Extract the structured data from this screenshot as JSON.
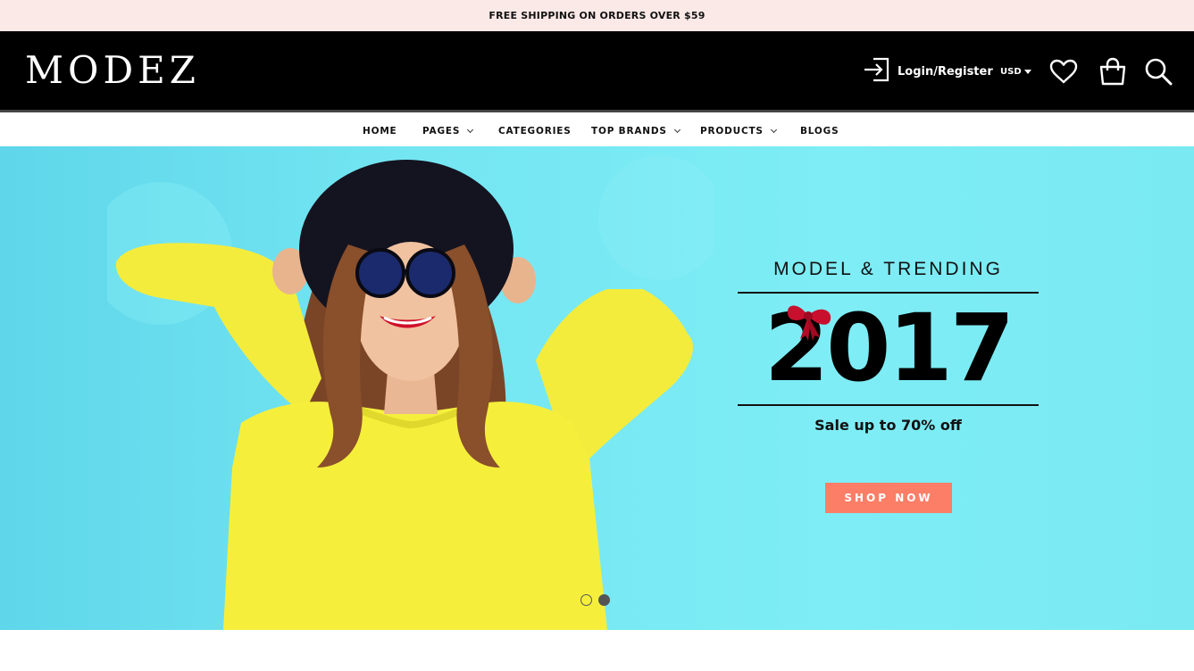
{
  "topbar": {
    "text": "FREE SHIPPING ON ORDERS OVER $59"
  },
  "header": {
    "logo": "MODEZ",
    "login_label": "Login/Register",
    "currency": "USD",
    "icons": [
      "login-icon",
      "heart-icon",
      "shopping-bag-icon",
      "search-icon"
    ]
  },
  "nav": {
    "items": [
      {
        "label": "HOME",
        "dropdown": false
      },
      {
        "label": "PAGES",
        "dropdown": true
      },
      {
        "label": "CATEGORIES",
        "dropdown": false
      },
      {
        "label": "TOP BRANDS",
        "dropdown": true
      },
      {
        "label": "PRODUCTS",
        "dropdown": true
      },
      {
        "label": "BLOGS",
        "dropdown": false
      }
    ]
  },
  "hero": {
    "tagline": "MODEL & TRENDING",
    "year": "2017",
    "sale": "Sale up to 70% off",
    "cta": "SHOP NOW",
    "slides_total": 2,
    "active_slide": 2
  },
  "colors": {
    "topbar_bg": "#fbe9e7",
    "header_bg": "#000000",
    "hero_bg": "#74e6f2",
    "cta_bg": "#fc7e66",
    "sweater": "#f5ef3c",
    "bow": "#c8102e"
  }
}
